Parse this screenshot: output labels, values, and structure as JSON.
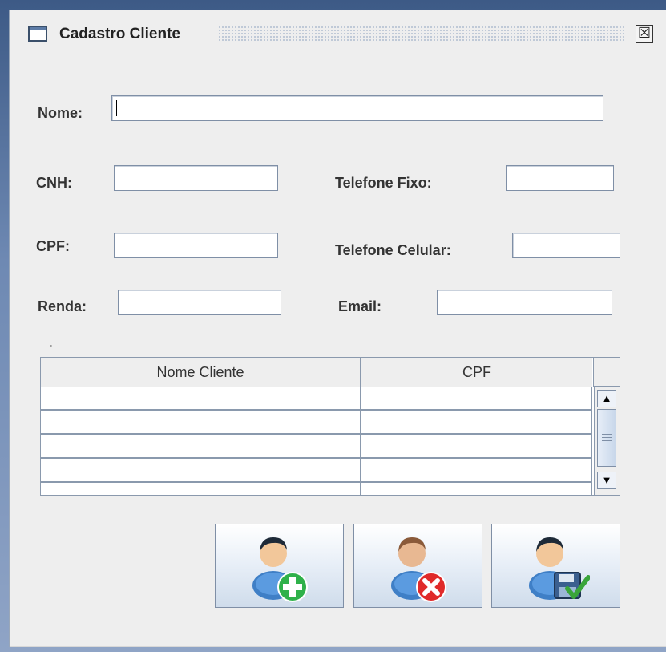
{
  "window": {
    "title": "Cadastro Cliente",
    "close_glyph": "☒"
  },
  "form": {
    "nome": {
      "label": "Nome:",
      "value": ""
    },
    "cnh": {
      "label": "CNH:",
      "value": ""
    },
    "telefone_fixo": {
      "label": "Telefone Fixo:",
      "value": ""
    },
    "cpf": {
      "label": "CPF:",
      "value": ""
    },
    "telefone_celular": {
      "label": "Telefone Celular:",
      "value": ""
    },
    "renda": {
      "label": "Renda:",
      "value": ""
    },
    "email": {
      "label": "Email:",
      "value": ""
    }
  },
  "table": {
    "columns": [
      "Nome Cliente",
      "CPF"
    ],
    "rows": [
      [
        "",
        ""
      ],
      [
        "",
        ""
      ],
      [
        "",
        ""
      ],
      [
        "",
        ""
      ],
      [
        "",
        ""
      ]
    ],
    "scroll_up_glyph": "▲",
    "scroll_down_glyph": "▼"
  },
  "buttons": [
    {
      "name": "add-client-button",
      "icon": "user-add-icon",
      "accent": "#2fb14a"
    },
    {
      "name": "delete-client-button",
      "icon": "user-delete-icon",
      "accent": "#e02a2a"
    },
    {
      "name": "save-client-button",
      "icon": "user-save-icon",
      "accent": "#3aa53a"
    }
  ]
}
